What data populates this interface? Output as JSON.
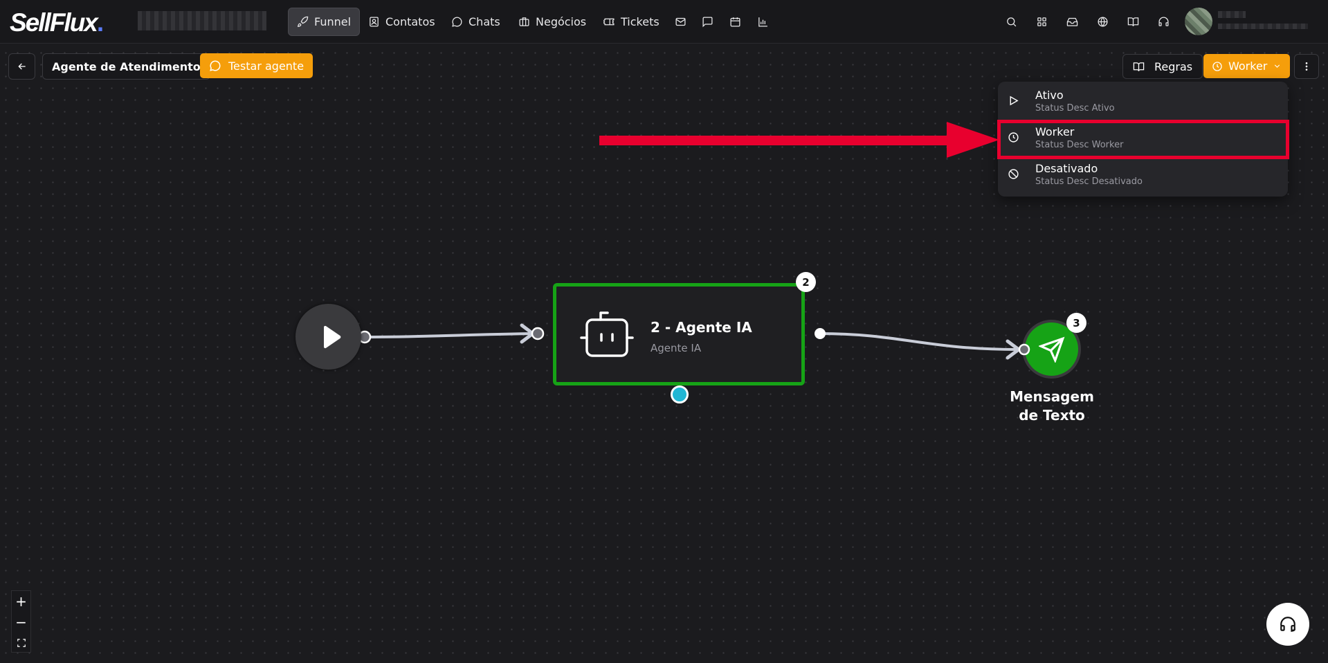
{
  "brand": {
    "name": "SellFlux",
    "dot": "."
  },
  "nav": {
    "items": [
      {
        "label": "Funnel",
        "icon": "rocket-icon",
        "active": true
      },
      {
        "label": "Contatos",
        "icon": "contacts-icon"
      },
      {
        "label": "Chats",
        "icon": "chat-icon"
      },
      {
        "label": "Negócios",
        "icon": "briefcase-icon"
      },
      {
        "label": "Tickets",
        "icon": "ticket-icon"
      }
    ],
    "extra_icons": [
      "mail-icon",
      "message-square-icon",
      "calendar-icon",
      "bar-chart-icon"
    ],
    "right_icons": [
      "search-icon",
      "apps-grid-icon",
      "inbox-icon",
      "globe-icon",
      "book-icon",
      "headset-icon"
    ]
  },
  "toolbar": {
    "agent_name": "Agente de Atendimento",
    "test_label": "Testar agente",
    "rules_label": "Regras",
    "status_label": "Worker"
  },
  "status_menu": {
    "items": [
      {
        "title": "Ativo",
        "desc": "Status Desc Ativo",
        "icon": "play-icon"
      },
      {
        "title": "Worker",
        "desc": "Status Desc Worker",
        "icon": "clock-icon",
        "highlighted": true
      },
      {
        "title": "Desativado",
        "desc": "Status Desc Desativado",
        "icon": "ban-icon"
      }
    ]
  },
  "flow": {
    "agent_node": {
      "badge": "2",
      "title": "2 - Agente IA",
      "subtitle": "Agente IA"
    },
    "message_node": {
      "badge": "3",
      "label_line1": "Mensagem",
      "label_line2": "de Texto"
    }
  },
  "zoom": {
    "plus": "+",
    "minus": "−"
  },
  "colors": {
    "accent": "#f59e0b",
    "node_green": "#16a316",
    "highlight_red": "#e8002e",
    "connector_blue": "#1fb6d4"
  }
}
